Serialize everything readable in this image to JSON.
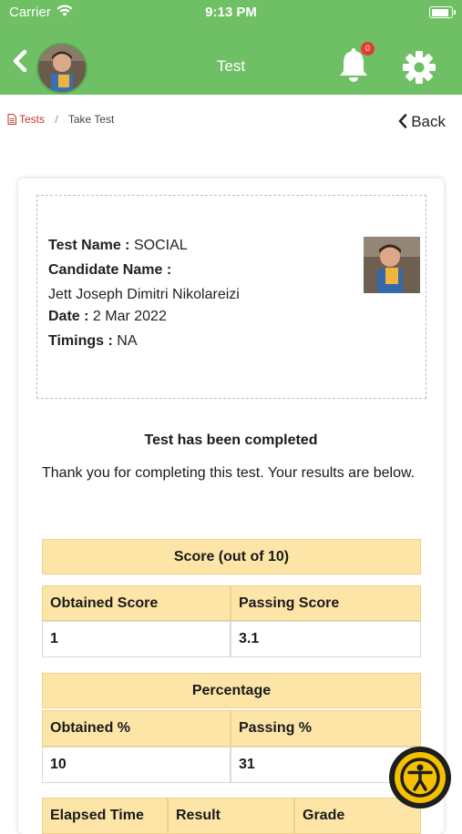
{
  "status_bar": {
    "carrier": "Carrier",
    "time": "9:13 PM"
  },
  "header": {
    "title": "Test",
    "notification_count": "0"
  },
  "breadcrumb": {
    "tests": "Tests",
    "separator": "/",
    "current": "Take Test"
  },
  "back_label": "Back",
  "info": {
    "test_name_label": "Test Name :",
    "test_name": "SOCIAL",
    "candidate_label": "Candidate Name :",
    "candidate_name": "Jett Joseph Dimitri Nikolareizi",
    "date_label": "Date :",
    "date": "2 Mar 2022",
    "timings_label": "Timings :",
    "timings": "NA"
  },
  "completion": {
    "title": "Test has been completed",
    "message": "Thank you for completing this test. Your results are below."
  },
  "score_table": {
    "title": "Score (out of 10)",
    "headers": [
      "Obtained Score",
      "Passing Score"
    ],
    "values": [
      "1",
      "3.1"
    ]
  },
  "percent_table": {
    "title": "Percentage",
    "headers": [
      "Obtained %",
      "Passing %"
    ],
    "values": [
      "10",
      "31"
    ]
  },
  "summary_table": {
    "headers": [
      "Elapsed Time",
      "Result",
      "Grade"
    ]
  },
  "colors": {
    "header_green": "#6fbf64",
    "table_header": "#fde5a8",
    "link_red": "#c0392b",
    "badge_red": "#e53935",
    "accessibility_yellow": "#f5c000"
  }
}
